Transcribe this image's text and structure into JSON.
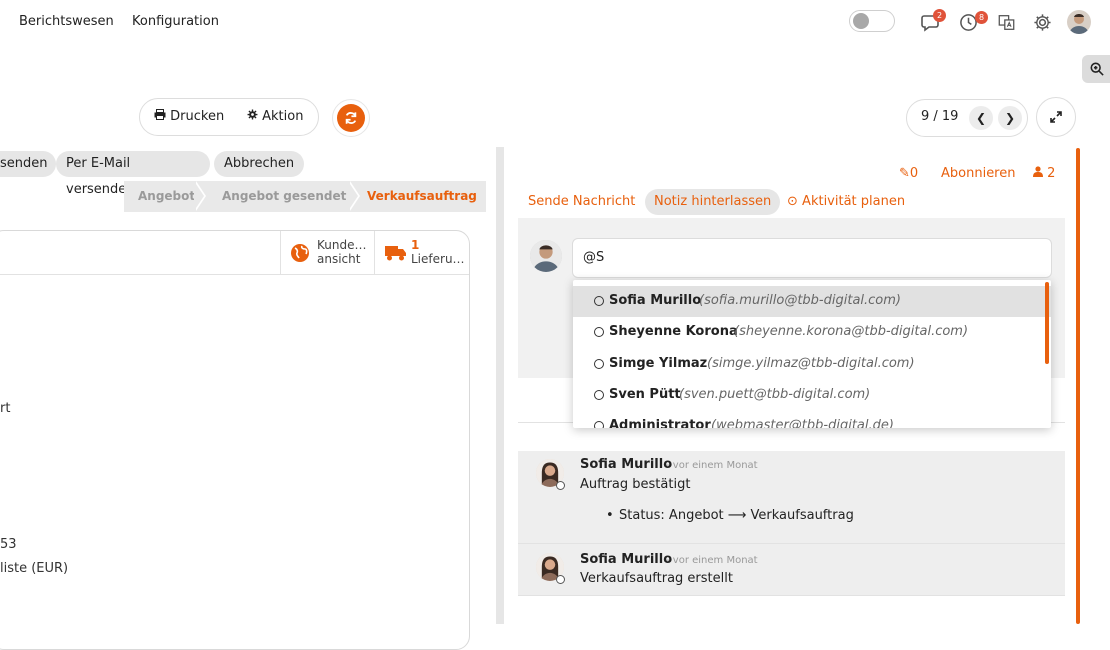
{
  "nav": {
    "menu": [
      "Berichtswesen",
      "Konfiguration"
    ],
    "messages_badge": "2",
    "activities_badge": "8"
  },
  "toolbar": {
    "print_label": "Drucken",
    "action_label": "Aktion"
  },
  "pager": {
    "text": "9 / 19"
  },
  "actions": {
    "send_fragment": "senden",
    "email_label": "Per E-Mail versenden",
    "cancel_label": "Abbrechen"
  },
  "stages": {
    "s1": "Angebot",
    "s2": "Angebot gesendet",
    "s3": "Verkaufsauftrag"
  },
  "smart_buttons": {
    "customer_line1": "Kunde…",
    "customer_line2": "ansicht",
    "delivery_count": "1",
    "delivery_label": "Lieferu…"
  },
  "form_fragments": {
    "f1": "rt",
    "f2": "53",
    "f3": "liste (EUR)"
  },
  "chatter": {
    "attachments": "0",
    "subscribe": "Abonnieren",
    "followers": "2",
    "tabs": {
      "send": "Sende Nachricht",
      "note": "Notiz hinterlassen",
      "activity": "Aktivität planen"
    },
    "composer_value": "@S",
    "mentions": [
      {
        "name": "Sofia Murillo",
        "email": "(sofia.murillo@tbb-digital.com)"
      },
      {
        "name": "Sheyenne Korona",
        "email": "(sheyenne.korona@tbb-digital.com)"
      },
      {
        "name": "Simge Yilmaz",
        "email": "(simge.yilmaz@tbb-digital.com)"
      },
      {
        "name": "Sven Pütt",
        "email": "(sven.puett@tbb-digital.com)"
      },
      {
        "name": "Administrator",
        "email": "(webmaster@tbb-digital.de)"
      }
    ],
    "messages": [
      {
        "author": "Sofia Murillo",
        "time": "- vor einem Monat",
        "body": "Auftrag bestätigt",
        "change": "Status: Angebot ⟶ Verkaufsauftrag"
      },
      {
        "author": "Sofia Murillo",
        "time": "- vor einem Monat",
        "body": "Verkaufsauftrag erstellt"
      }
    ]
  },
  "colors": {
    "accent": "#e8600e",
    "badge": "#e0533a"
  }
}
